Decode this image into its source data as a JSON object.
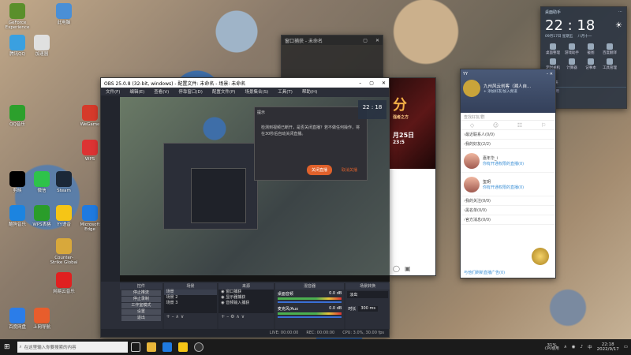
{
  "desktop_icons": [
    {
      "label": "GeForce Experience",
      "color": "#5a8f2b"
    },
    {
      "label": "此电脑",
      "color": "#4a8fd6"
    },
    {
      "label": "腾讯QQ",
      "color": "#3aa0e0"
    },
    {
      "label": "加速器",
      "color": "#e0e0e0"
    },
    {
      "label": "WeGame",
      "color": "#d63a2a"
    },
    {
      "label": "Steam",
      "color": "#1b2838"
    },
    {
      "label": "WPS",
      "color": "#d33"
    },
    {
      "label": "QQ音乐",
      "color": "#2ca02c"
    },
    {
      "label": "剪映",
      "color": "#000"
    },
    {
      "label": "微信",
      "color": "#2ec34a"
    },
    {
      "label": "酷狗音乐",
      "color": "#1c84e0"
    },
    {
      "label": "WPS表格",
      "color": "#2a9d2a"
    },
    {
      "label": "YY语音",
      "color": "#f5c516"
    },
    {
      "label": "Microsoft Edge",
      "color": "#1f7ae0"
    },
    {
      "label": "百度网盘",
      "color": "#2b7de9"
    },
    {
      "label": "上网导航",
      "color": "#e85d2c"
    },
    {
      "label": "网易云音乐",
      "color": "#e02020"
    },
    {
      "label": "Counter-Strike Global",
      "color": "#d8a83b"
    }
  ],
  "obs": {
    "title": "OBS 25.0.8 (32-bit, windows) - 配置文件: 未命名 - 场景: 未命名",
    "menu": [
      "文件(F)",
      "编辑(E)",
      "查看(V)",
      "停靠窗口(D)",
      "配置文件(P)",
      "场景集合(S)",
      "工具(T)",
      "帮助(H)"
    ],
    "dialog": {
      "title": "提示",
      "message": "检测到视频已断开，是否关闭直播？若不做任何操作，将在30秒后自动关闭直播。",
      "primary": "关闭直播",
      "secondary": "取消关播"
    },
    "docks": {
      "controls_title": "控件",
      "controls": [
        "停止推流",
        "停止录制",
        "工作室模式",
        "设置",
        "退出"
      ],
      "scenes_title": "场景",
      "scenes": [
        "场景",
        "场景 2",
        "场景 3"
      ],
      "sources_title": "来源",
      "sources": [
        "窗口捕获",
        "显示器捕获",
        "音频输入捕获"
      ],
      "mixer_title": "混音器",
      "mixer": [
        {
          "name": "桌面音频",
          "value": "0.0 dB"
        },
        {
          "name": "麦克风/Aux",
          "value": "0.0 dB"
        }
      ],
      "transitions_title": "场景转换",
      "transition": "淡出",
      "duration_label": "时长",
      "duration": "300 ms"
    },
    "status": {
      "live": "LIVE: 00:00:00",
      "rec": "REC: 00:00:00",
      "cpu": "CPU: 3.0%, 30.00 fps"
    }
  },
  "clock_widget": {
    "title": "桌面助手",
    "time": "22 : 18",
    "date": "09月17日 星期五",
    "lunar": "八月十一",
    "buttons": [
      "桌面整理",
      "游戏助手",
      "截图",
      "百度翻译",
      "定时关机",
      "计算器",
      "记事本",
      "工具管理",
      "文件夹"
    ],
    "section": "桌面常用"
  },
  "yy": {
    "title": "九州风云创客（湘人自...",
    "subtitle": "+ 添加好友/加入频道",
    "search_placeholder": "查找好友/群",
    "groups": [
      "最近联系人(0/0)",
      "我的好友(2/2)",
      "我的关注(0/0)",
      "黑名单(0/0)",
      "官方消息(0/0)"
    ],
    "friends": [
      {
        "name": "嘉年华_i",
        "status": "你有开通权限的直播(0)"
      },
      {
        "name": "玺玥",
        "status": "你有开通权限的直播(0)"
      }
    ],
    "footer_tip": "与他们刷新直播广告(0)"
  },
  "recorder_window": {
    "title": "窗口捕获 - 未命名"
  },
  "promo": {
    "banner_text": "分",
    "sub_text": "强者之方",
    "date_text": "月25日",
    "time_text": "23:5"
  },
  "taskbar": {
    "search_placeholder": "在这里输入你要搜索的内容",
    "cpu": "31%",
    "cpu_label": "CPU使用",
    "time": "22:18",
    "date": "2022/9/17",
    "lang": "中"
  }
}
